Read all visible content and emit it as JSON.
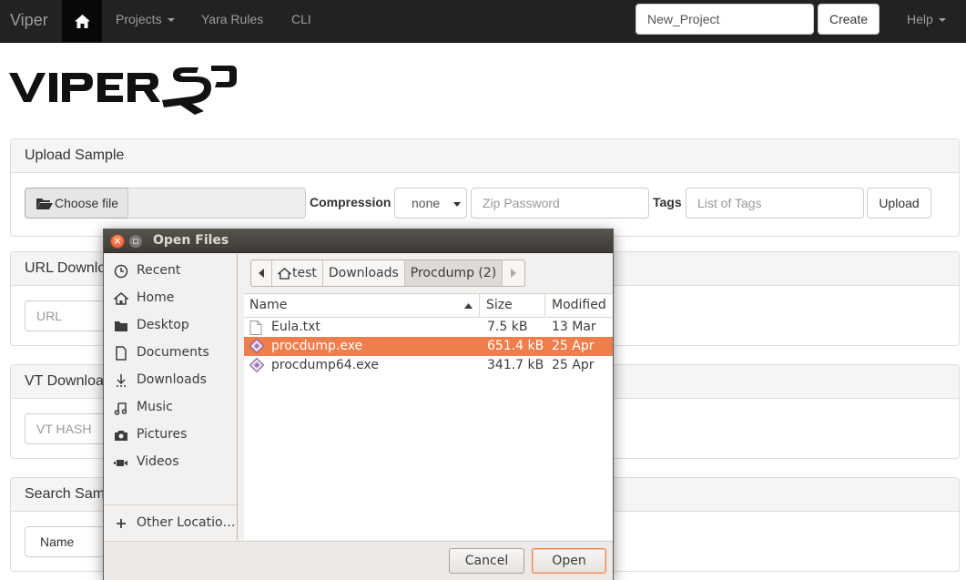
{
  "navbar": {
    "brand": "Viper",
    "home_icon": "home-icon",
    "projects_label": "Projects",
    "yara_label": "Yara Rules",
    "cli_label": "CLI",
    "project_name_value": "New_Project",
    "create_label": "Create",
    "help_label": "Help"
  },
  "upload": {
    "title": "Upload Sample",
    "choose_file_label": "Choose file",
    "compression_label": "Compression",
    "compression_value": "none",
    "zip_password_placeholder": "Zip Password",
    "tags_label": "Tags",
    "tags_placeholder": "List of Tags",
    "upload_label": "Upload"
  },
  "url_download": {
    "title": "URL Download",
    "url_placeholder": "URL"
  },
  "vt_download": {
    "title": "VT Download",
    "hash_placeholder": "VT HASH"
  },
  "search": {
    "title": "Search Samples",
    "field_value": "Name"
  },
  "dialog": {
    "title": "Open Files",
    "sidebar": [
      {
        "label": "Recent",
        "icon": "clock-icon"
      },
      {
        "label": "Home",
        "icon": "home-icon"
      },
      {
        "label": "Desktop",
        "icon": "folder-icon"
      },
      {
        "label": "Documents",
        "icon": "document-icon"
      },
      {
        "label": "Downloads",
        "icon": "download-icon"
      },
      {
        "label": "Music",
        "icon": "music-icon"
      },
      {
        "label": "Pictures",
        "icon": "camera-icon"
      },
      {
        "label": "Videos",
        "icon": "video-icon"
      }
    ],
    "other_locations": "Other Locatio…",
    "path": [
      "test",
      "Downloads",
      "Procdump (2)"
    ],
    "columns": {
      "name": "Name",
      "size": "Size",
      "modified": "Modified"
    },
    "files": [
      {
        "name": "Eula.txt",
        "size": "7.5 kB",
        "modified": "13 Mar",
        "icon": "text-file-icon",
        "selected": false
      },
      {
        "name": "procdump.exe",
        "size": "651.4 kB",
        "modified": "25 Apr",
        "icon": "executable-icon",
        "selected": true
      },
      {
        "name": "procdump64.exe",
        "size": "341.7 kB",
        "modified": "25 Apr",
        "icon": "executable-icon",
        "selected": false
      }
    ],
    "cancel_label": "Cancel",
    "open_label": "Open"
  },
  "colors": {
    "navbar_bg": "#222222",
    "selection": "#ee7e4c",
    "titlebar": "#3d3b37"
  }
}
